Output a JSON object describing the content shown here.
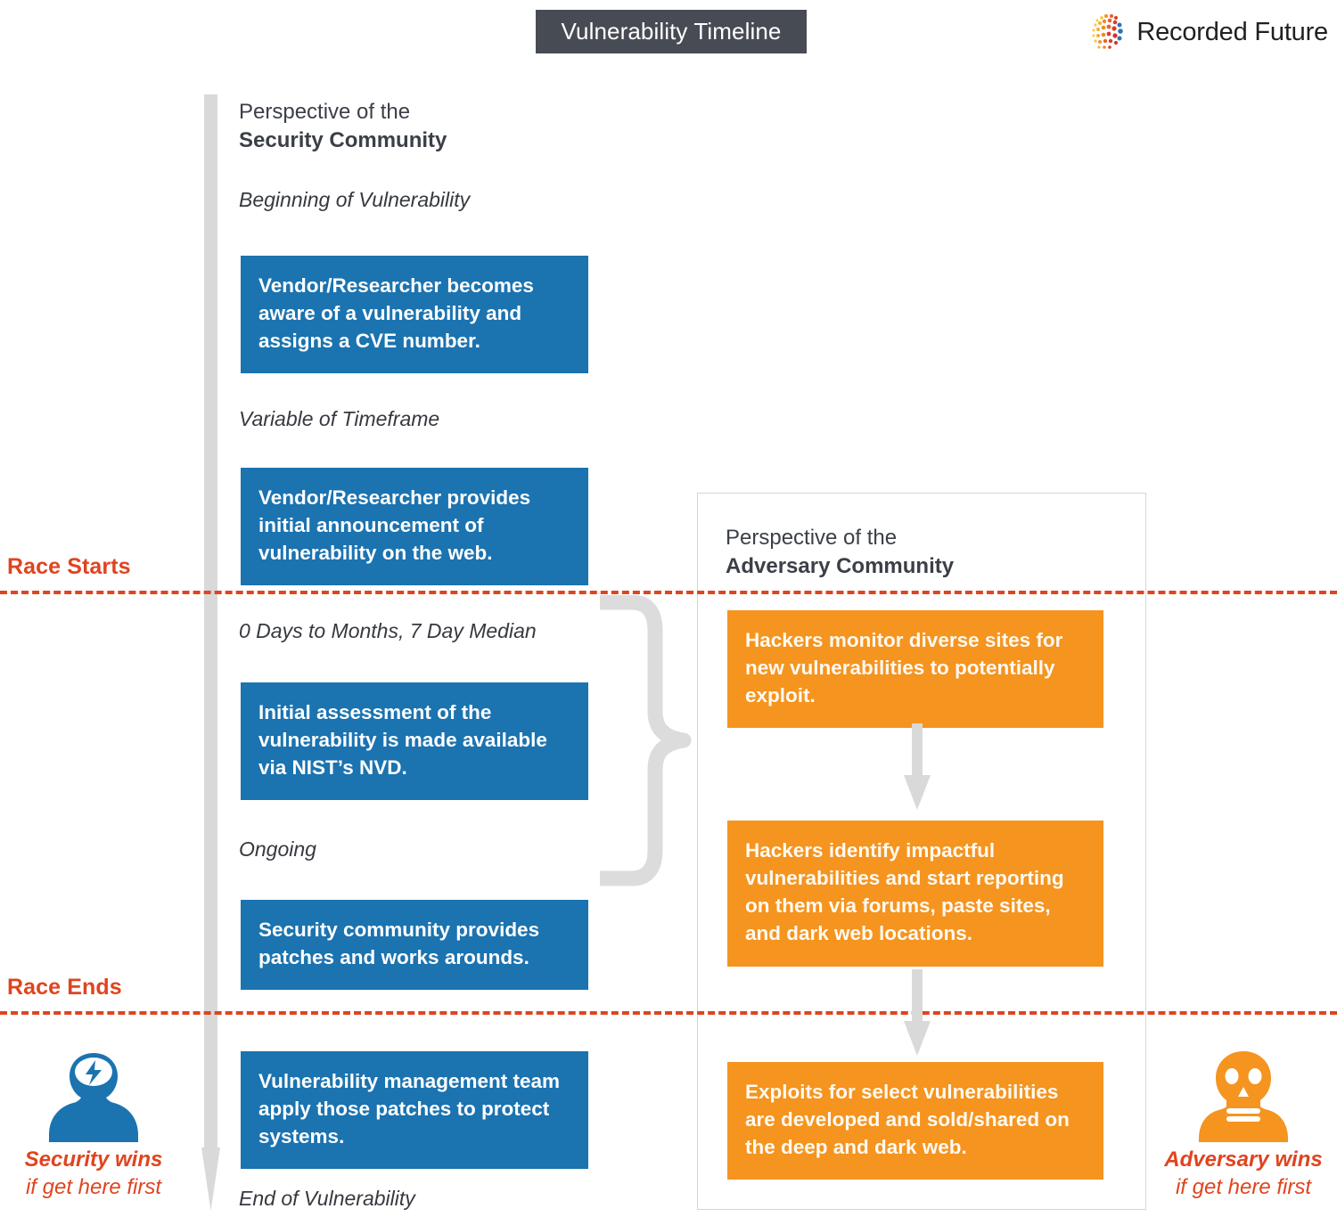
{
  "header": {
    "title": "Vulnerability Timeline",
    "brand_name": "Recorded Future",
    "brand_mark_icon": "recorded-future-dots-logo"
  },
  "colors": {
    "title_chip_bg": "#474B54",
    "security_blue": "#1B73B0",
    "adversary_orange": "#F5941F",
    "race_red": "#E0441F",
    "timeline_gray": "#D9D9D9",
    "text_dark": "#3B3F47"
  },
  "security_column": {
    "perspective_prefix": "Perspective of the",
    "perspective_name": "Security Community",
    "phases": [
      {
        "label": "Beginning of Vulnerability"
      },
      {
        "label": "Variable of Timeframe"
      },
      {
        "label": "0 Days to Months, 7 Day Median"
      },
      {
        "label": "Ongoing"
      },
      {
        "label": "End of Vulnerability"
      }
    ],
    "steps": [
      {
        "text": "Vendor/Researcher becomes aware of a vulnerability and assigns a CVE number."
      },
      {
        "text": "Vendor/Researcher provides initial announcement of vulnerability on the web."
      },
      {
        "text": "Initial assessment of the vulnerability is made available via NIST’s NVD."
      },
      {
        "text": "Security community provides patches and works arounds."
      },
      {
        "text": "Vulnerability management team apply those patches to protect systems."
      }
    ]
  },
  "adversary_column": {
    "perspective_prefix": "Perspective of the",
    "perspective_name": "Adversary Community",
    "steps": [
      {
        "text": "Hackers monitor diverse sites for new vulnerabilities to potentially exploit."
      },
      {
        "text": "Hackers identify impactful vulnerabilities and start reporting on them via forums, paste sites, and dark web locations."
      },
      {
        "text": "Exploits for select vulnerabilities are developed and sold/shared on the deep and dark web."
      }
    ]
  },
  "race": {
    "start_label": "Race Starts",
    "end_label": "Race Ends"
  },
  "outcomes": {
    "security": {
      "icon": "security-analyst-avatar-icon",
      "line1": "Security wins",
      "line2": "if get here first"
    },
    "adversary": {
      "icon": "skull-adversary-avatar-icon",
      "line1": "Adversary wins",
      "line2": "if get here first"
    }
  }
}
